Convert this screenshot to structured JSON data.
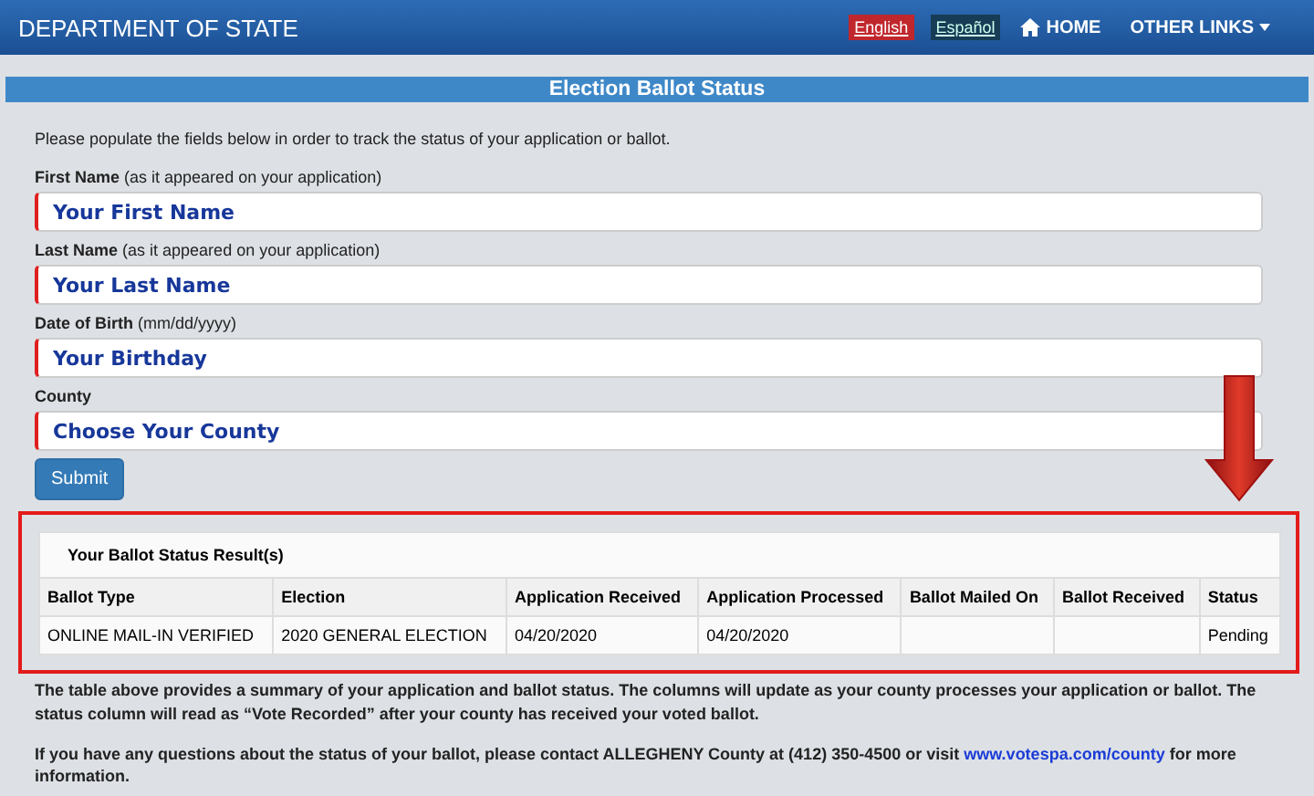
{
  "header": {
    "title": "DEPARTMENT OF STATE",
    "languages": [
      {
        "label": "English",
        "selected": true
      },
      {
        "label": "Español",
        "selected": false
      }
    ],
    "links": [
      {
        "label": "HOME",
        "kind": "home"
      },
      {
        "label": "OTHER LINKS",
        "kind": "dropdown"
      }
    ]
  },
  "page_title": "Election Ballot Status",
  "intro": "Please populate the fields below in order to track the status of your application or ballot.",
  "fields": [
    {
      "label": "First Name",
      "hint": "(as it appeared on your application)",
      "placeholder": "Your First Name",
      "kind": "text"
    },
    {
      "label": "Last Name",
      "hint": "(as it appeared on your application)",
      "placeholder": "Your Last Name",
      "kind": "text"
    },
    {
      "label": "Date of Birth",
      "hint": "(mm/dd/yyyy)",
      "placeholder": "Your Birthday",
      "kind": "text"
    },
    {
      "label": "County",
      "placeholder": "Choose Your County",
      "kind": "select"
    }
  ],
  "submit": "Submit",
  "results": {
    "title": "Your Ballot Status Result(s)",
    "columns": [
      "Ballot Type",
      "Election",
      "Application Received",
      "Application Processed",
      "Ballot Mailed On",
      "Ballot Received",
      "Status"
    ],
    "rows": [
      [
        "ONLINE MAIL-IN VERIFIED",
        "2020 GENERAL ELECTION",
        "04/20/2020",
        "04/20/2020",
        "",
        "",
        "Pending"
      ]
    ]
  },
  "note": "The table above provides a summary of your application and ballot status. The columns will update as your county processes your application or ballot. The status column will read as “Vote Recorded” after your county has received your voted ballot.",
  "contact": {
    "text": "If you have any questions about the status of your ballot, please contact ALLEGHENY County at (412) 350-4500 or visit",
    "link": "www.votespa.com/county",
    "after": "for more information."
  }
}
